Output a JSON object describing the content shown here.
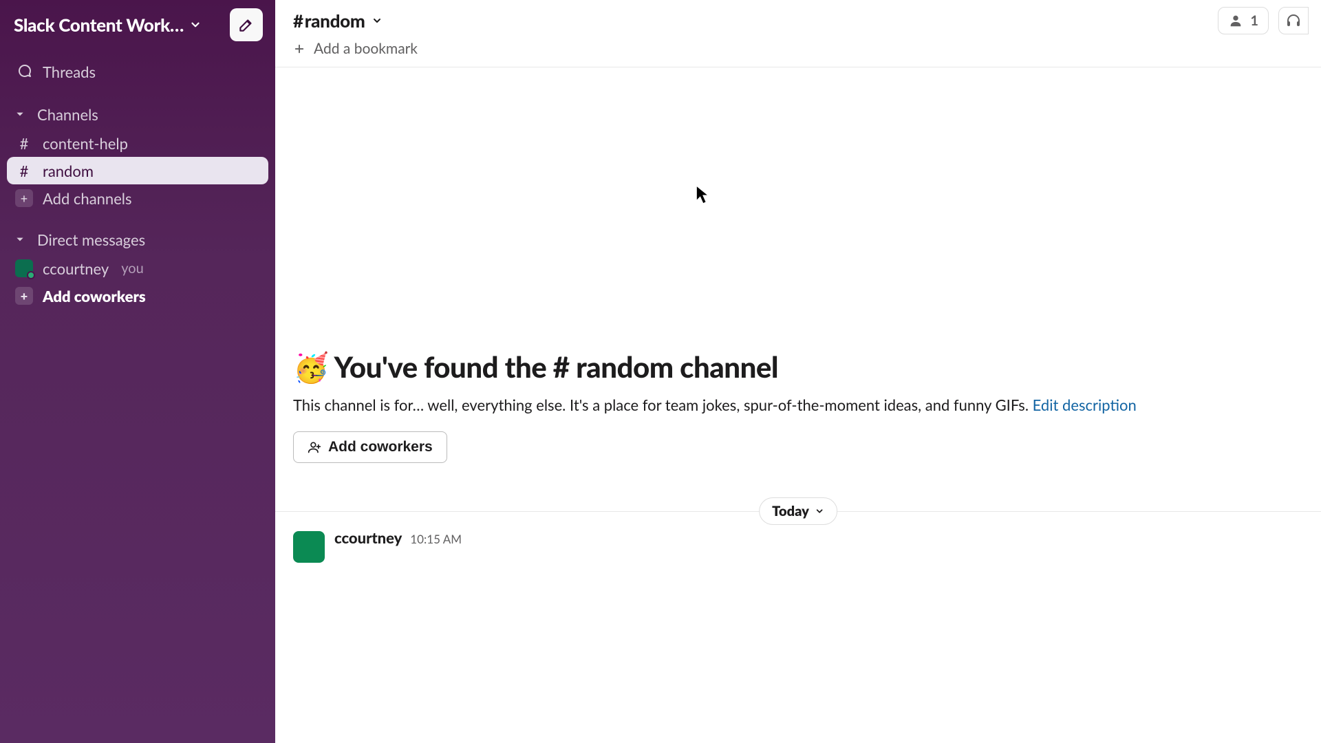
{
  "workspace": {
    "name": "Slack Content Work…"
  },
  "sidebar": {
    "threads_label": "Threads",
    "channels_header": "Channels",
    "channels": [
      {
        "name": "content-help",
        "active": false
      },
      {
        "name": "random",
        "active": true
      }
    ],
    "add_channels_label": "Add channels",
    "dms_header": "Direct messages",
    "dms": [
      {
        "name": "ccourtney",
        "you": true
      }
    ],
    "you_tag": "you",
    "add_coworkers_label": "Add coworkers"
  },
  "header": {
    "channel_name": "random",
    "bookmark_label": "Add a bookmark",
    "member_count": "1"
  },
  "welcome": {
    "emoji": "🥳",
    "title": "You've found the # random channel",
    "desc": "This channel is for… well, everything else. It's a place for team jokes, spur-of-the-moment ideas, and funny GIFs. ",
    "edit": "Edit description",
    "add_coworkers_btn": "Add coworkers"
  },
  "divider": {
    "label": "Today"
  },
  "message": {
    "author": "ccourtney",
    "time": "10:15 AM"
  }
}
